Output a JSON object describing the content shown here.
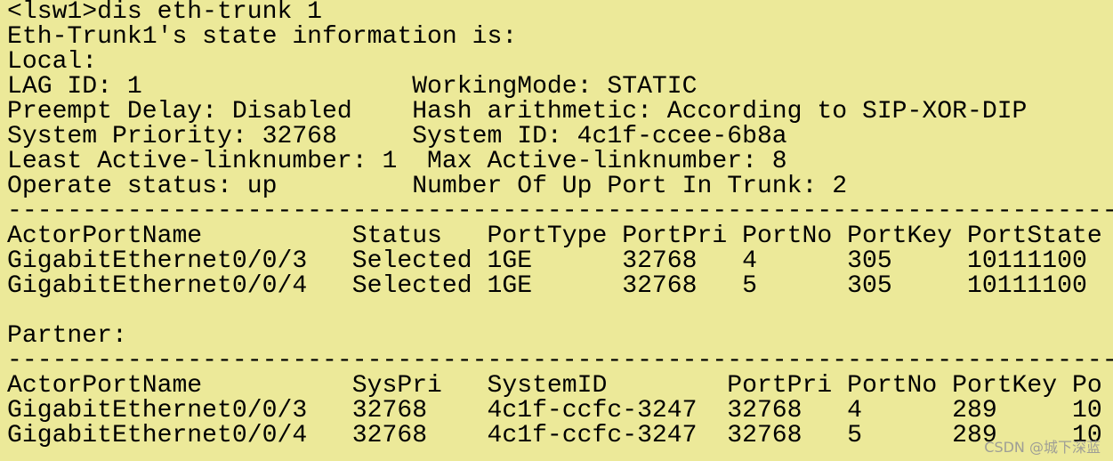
{
  "terminal": {
    "lines": [
      "<lsw1>dis eth-trunk 1",
      "Eth-Trunk1's state information is:",
      "Local:",
      "LAG ID: 1                  WorkingMode: STATIC",
      "Preempt Delay: Disabled    Hash arithmetic: According to SIP-XOR-DIP",
      "System Priority: 32768     System ID: 4c1f-ccee-6b8a",
      "Least Active-linknumber: 1  Max Active-linknumber: 8",
      "Operate status: up         Number Of Up Port In Trunk: 2",
      "------------------------------------------------------------------------------",
      "ActorPortName          Status   PortType PortPri PortNo PortKey PortState",
      "GigabitEthernet0/0/3   Selected 1GE      32768   4      305     10111100",
      "GigabitEthernet0/0/4   Selected 1GE      32768   5      305     10111100",
      "",
      "Partner:",
      "------------------------------------------------------------------------------",
      "ActorPortName          SysPri   SystemID        PortPri PortNo PortKey Po",
      "GigabitEthernet0/0/3   32768    4c1f-ccfc-3247  32768   4      289     10",
      "GigabitEthernet0/0/4   32768    4c1f-ccfc-3247  32768   5      289     10"
    ],
    "background_color": "#ece999",
    "text_color": "#000000"
  },
  "watermark": {
    "text": "CSDN @城下深蓝"
  }
}
